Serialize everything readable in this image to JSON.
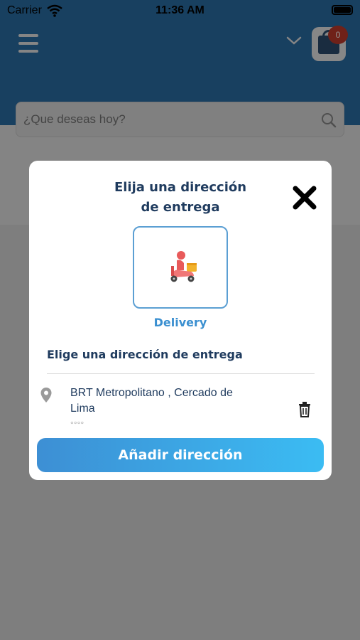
{
  "status_bar": {
    "carrier": "Carrier",
    "time": "11:36 AM"
  },
  "header": {
    "cart_count": "0"
  },
  "search": {
    "placeholder": "¿Que deseas hoy?"
  },
  "modal": {
    "title_line1": "Elija una dirección",
    "title_line2": "de entrega",
    "delivery_option": {
      "label": "Delivery",
      "icon": "scooter-icon"
    },
    "section_title": "Elige una dirección de entrega",
    "addresses": [
      {
        "line": "BRT Metropolitano , Cercado de Lima",
        "sub": "°°°°"
      }
    ],
    "add_button_label": "Añadir dirección"
  },
  "colors": {
    "header_bg": "#2a6ea6",
    "title_text": "#1f3b5e",
    "accent_blue": "#3a8fd0",
    "button_gradient_start": "#3d8fd4",
    "button_gradient_end": "#3bbcf3",
    "badge_red": "#c0392b"
  }
}
